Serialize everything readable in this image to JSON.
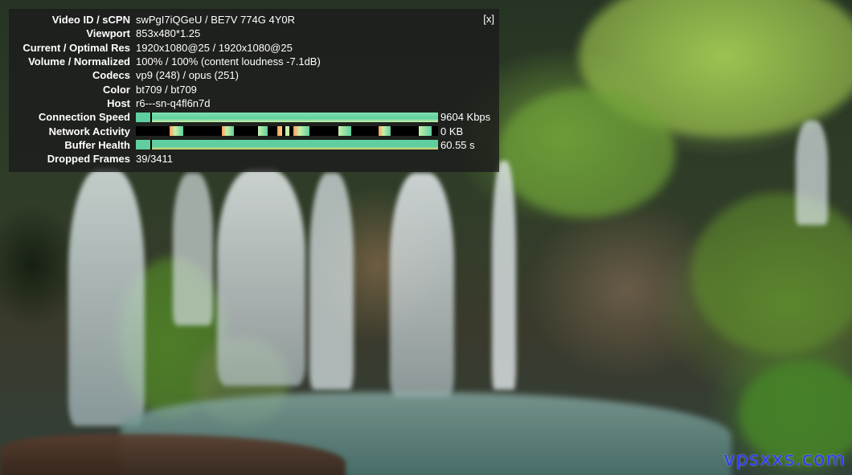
{
  "stats": {
    "close_label": "[x]",
    "rows": [
      {
        "label": "Video ID / sCPN",
        "value": "swPgI7iQGeU / BE7V 774G 4Y0R"
      },
      {
        "label": "Viewport",
        "value": "853x480*1.25"
      },
      {
        "label": "Current / Optimal Res",
        "value": "1920x1080@25 / 1920x1080@25"
      },
      {
        "label": "Volume / Normalized",
        "value": "100% / 100% (content loudness -7.1dB)"
      },
      {
        "label": "Codecs",
        "value": "vp9 (248) / opus (251)"
      },
      {
        "label": "Color",
        "value": "bt709 / bt709"
      },
      {
        "label": "Host",
        "value": "r6---sn-q4fl6n7d"
      }
    ],
    "connection_speed": {
      "label": "Connection Speed",
      "value": "9604 Kbps",
      "fill_fraction": 1.0
    },
    "network_activity": {
      "label": "Network Activity",
      "value": "0 KB"
    },
    "buffer_health": {
      "label": "Buffer Health",
      "value": "60.55 s",
      "fill_fraction": 1.0
    },
    "dropped_frames": {
      "label": "Dropped Frames",
      "value": "39/3411"
    }
  },
  "watermark": "vpsxxs.com",
  "colors": {
    "graph_primary": "#5fcfa0",
    "graph_light": "#c8f0a8",
    "graph_accent": "#ff9e5a",
    "panel_bg": "rgba(28,28,28,0.80)",
    "watermark": "#2f3cff"
  }
}
